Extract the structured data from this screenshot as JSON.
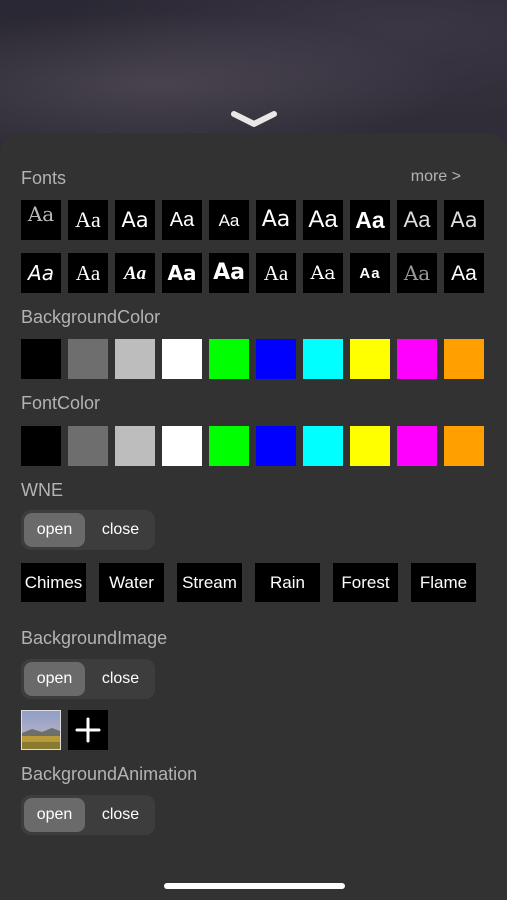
{
  "sections": {
    "fonts": "Fonts",
    "more": "more >",
    "background_color": "BackgroundColor",
    "font_color": "FontColor",
    "wne": "WNE",
    "background_image": "BackgroundImage",
    "background_animation": "BackgroundAnimation"
  },
  "font_samples": [
    "Aa",
    "Aa",
    "Aa",
    "Aa",
    "Aa",
    "Aa",
    "Aa",
    "Aa",
    "Aa",
    "Aa",
    "Aa",
    "Aa",
    "Aa",
    "Aa",
    "Aa",
    "Aa",
    "Aa",
    "Aa",
    "Aa",
    "Aa"
  ],
  "colors": [
    "#000000",
    "#6e6e6e",
    "#bdbdbd",
    "#ffffff",
    "#00ff00",
    "#0000ff",
    "#00ffff",
    "#ffff00",
    "#ff00ff",
    "#ff9f00"
  ],
  "toggle": {
    "open": "open",
    "close": "close"
  },
  "sounds": [
    "Chimes",
    "Water",
    "Stream",
    "Rain",
    "Forest",
    "Flame"
  ]
}
